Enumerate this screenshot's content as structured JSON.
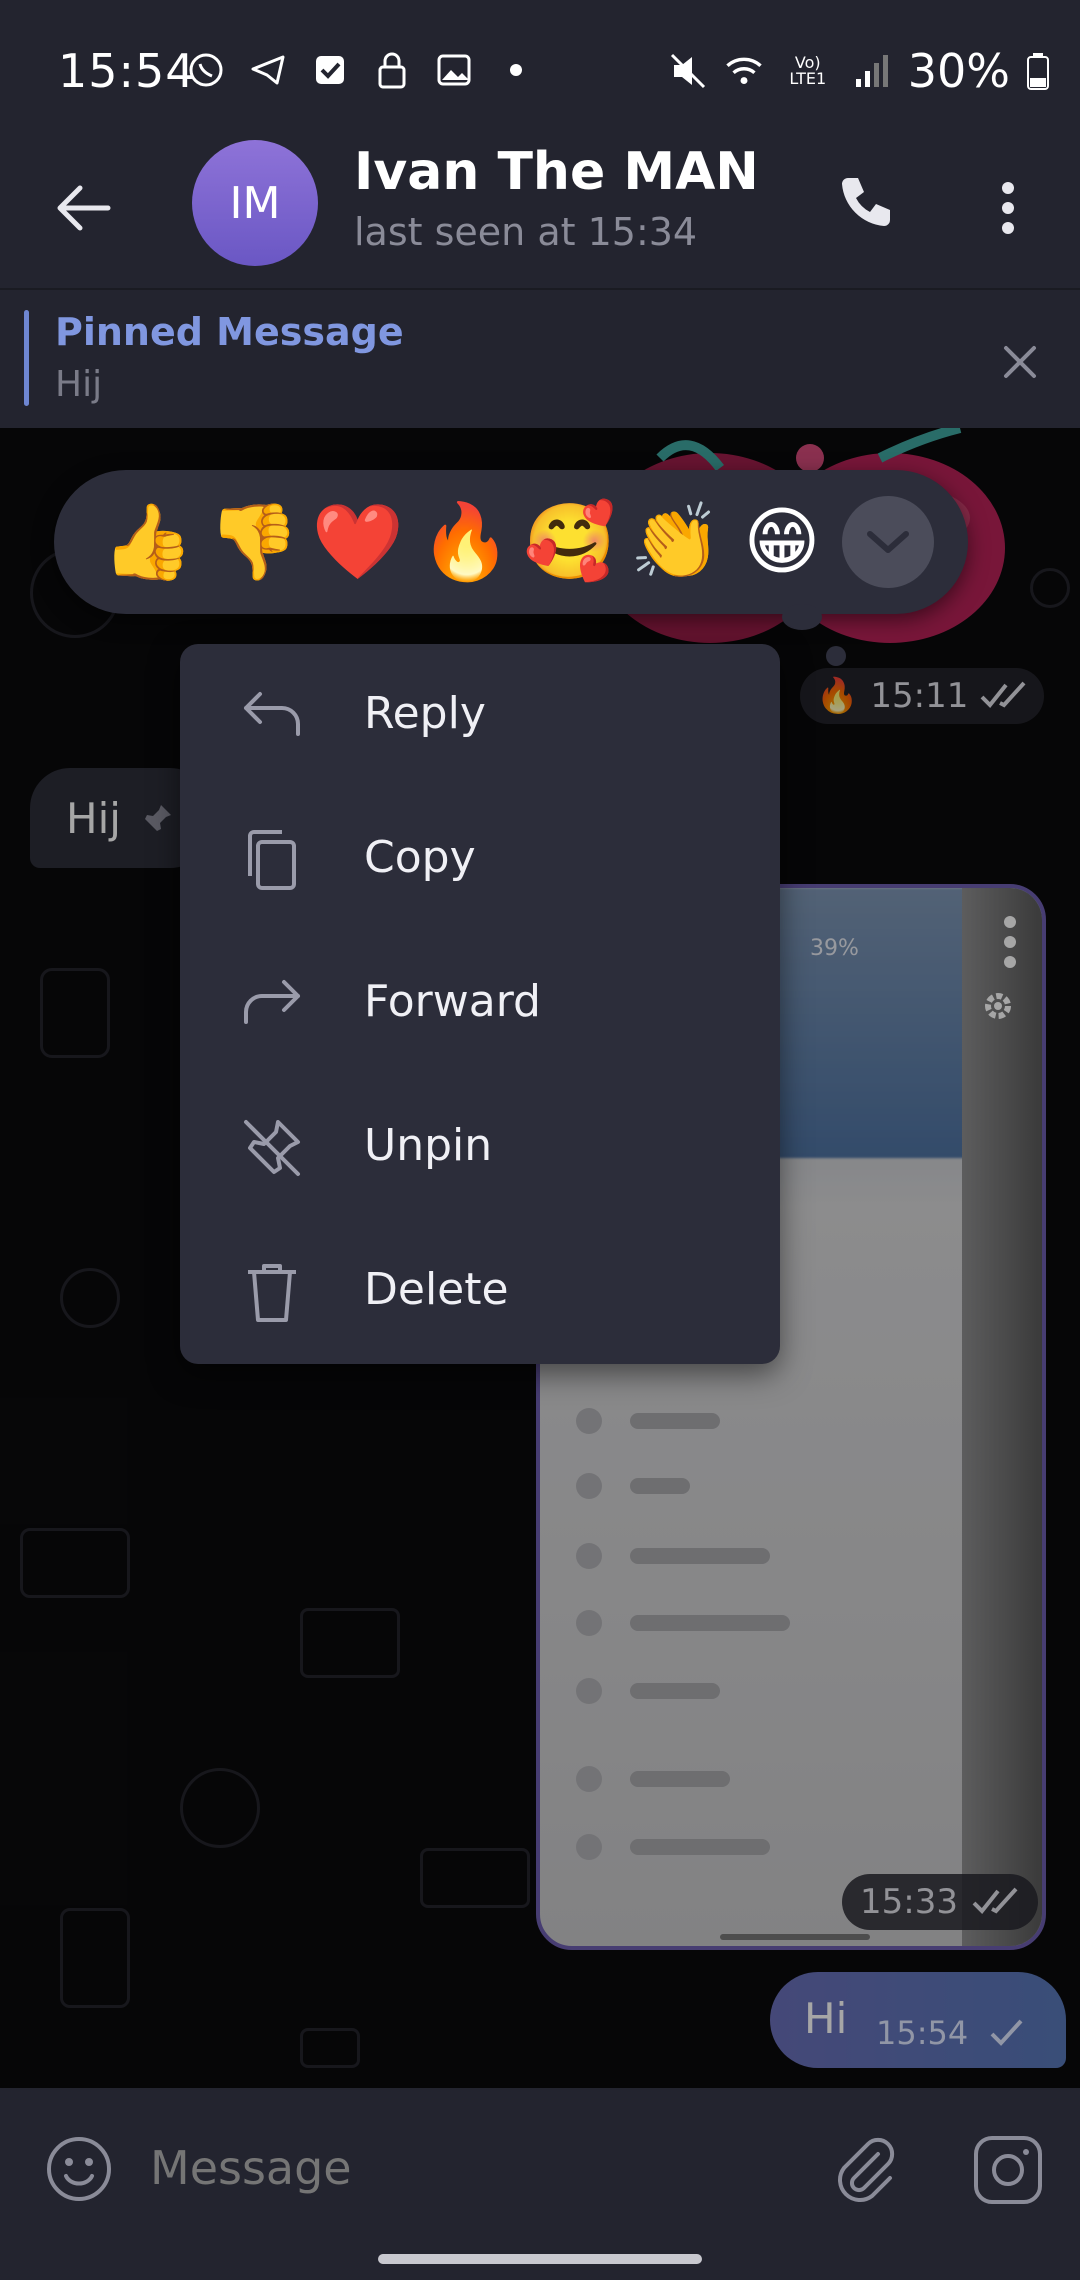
{
  "status_bar": {
    "time": "15:54",
    "battery": "30%",
    "left_icons": [
      "whatsapp-icon",
      "telegram-icon",
      "checkbox-icon",
      "lock-icon",
      "image-icon",
      "dot-icon"
    ],
    "right_icons": [
      "mute-icon",
      "wifi-icon",
      "volte-icon",
      "signal-icon",
      "battery-icon"
    ],
    "volte_label": "Vo) LTE1"
  },
  "header": {
    "avatar_initials": "IM",
    "contact_name": "Ivan The MAN",
    "last_seen": "last seen at 15:34"
  },
  "pinned": {
    "title": "Pinned Message",
    "text": "Hij"
  },
  "reactions": [
    "👍",
    "👎",
    "❤️",
    "🔥",
    "🥰",
    "👏",
    "😁"
  ],
  "context_menu": {
    "items": [
      {
        "label": "Reply",
        "icon": "reply-icon"
      },
      {
        "label": "Copy",
        "icon": "copy-icon"
      },
      {
        "label": "Forward",
        "icon": "forward-icon"
      },
      {
        "label": "Unpin",
        "icon": "unpin-icon"
      },
      {
        "label": "Delete",
        "icon": "trash-icon"
      }
    ]
  },
  "messages": {
    "sticker_reaction": "🔥",
    "sticker_time": "15:11",
    "incoming_text": "Hij",
    "screenshot_status": "39%",
    "screenshot_time": "15:33",
    "outgoing_text": "Hi",
    "outgoing_time": "15:54"
  },
  "input": {
    "placeholder": "Message"
  },
  "colors": {
    "header_bg": "#23242f",
    "accent": "#8097e0",
    "menu_bg": "#2c2d3a",
    "outgoing_bubble": "#5f74b8"
  }
}
